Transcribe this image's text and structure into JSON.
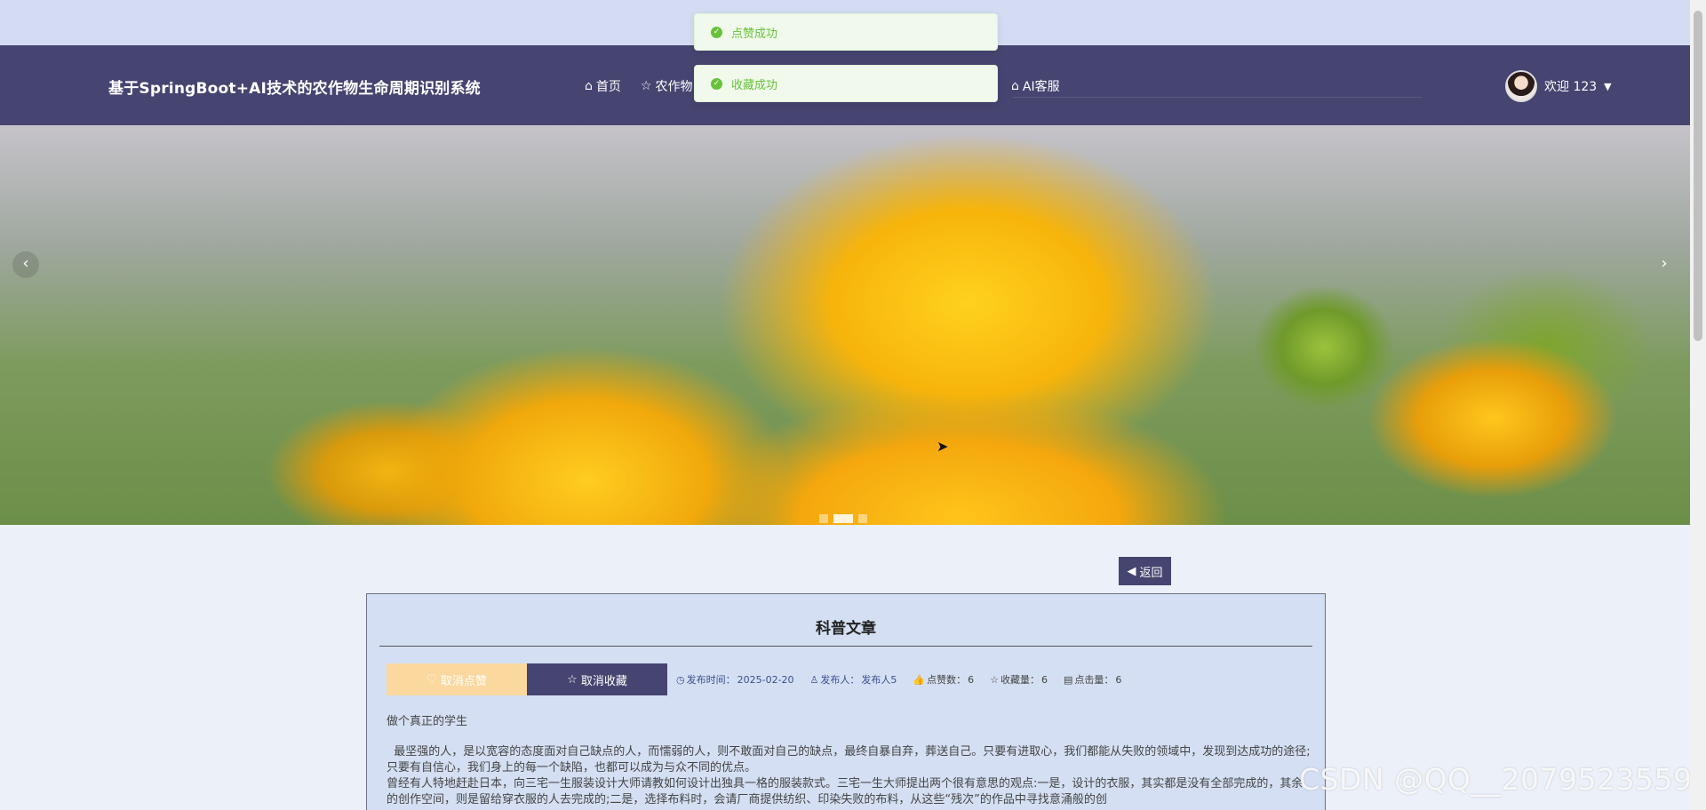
{
  "header": {
    "brand": "基于SpringBoot+AI技术的农作物生命周期识别系统",
    "nav": [
      {
        "label": "首页",
        "icon": "home-icon"
      },
      {
        "label": "农作物",
        "icon": "star-icon"
      },
      {
        "label": "AI客服",
        "icon": "home-icon"
      }
    ],
    "user": {
      "greeting": "欢迎 123"
    }
  },
  "toasts": [
    {
      "text": "点赞成功",
      "type": "success"
    },
    {
      "text": "收藏成功",
      "type": "success"
    }
  ],
  "carousel": {
    "indicator_count": 3,
    "active_index": 1
  },
  "back_button": "返回",
  "article": {
    "title": "科普文章",
    "like_button": "取消点赞",
    "favorite_button": "取消收藏",
    "meta": {
      "publish_time_label": "发布时间：",
      "publish_time": "2025-02-20",
      "author_label": "发布人：",
      "author": "发布人5",
      "likes_label": "点赞数：",
      "likes": "6",
      "favorites_label": "收藏量：",
      "favorites": "6",
      "clicks_label": "点击量：",
      "clicks": "6"
    },
    "subtitle": "做个真正的学生",
    "paragraphs": [
      "  最坚强的人，是以宽容的态度面对自己缺点的人，而懦弱的人，则不敢面对自己的缺点，最终自暴自弃，葬送自己。只要有进取心，我们都能从失败的领域中，发现到达成功的途径;只要有自信心，我们身上的每一个缺陷，也都可以成为与众不同的优点。",
      "曾经有人特地赶赴日本，向三宅一生服装设计大师请教如何设计出独具一格的服装款式。三宅一生大师提出两个很有意思的观点:一是，设计的衣服，其实都是没有全部完成的，其余的创作空间，则是留给穿衣服的人去完成的;二是，选择布料时，会请厂商提供纺织、印染失败的布料，从这些“残次”的作品中寻找意涌般的创"
    ]
  },
  "watermark": "CSDN @QQ__2079523559",
  "colors": {
    "header": "#464470",
    "like": "#fad89e",
    "success": "#67c23a"
  }
}
